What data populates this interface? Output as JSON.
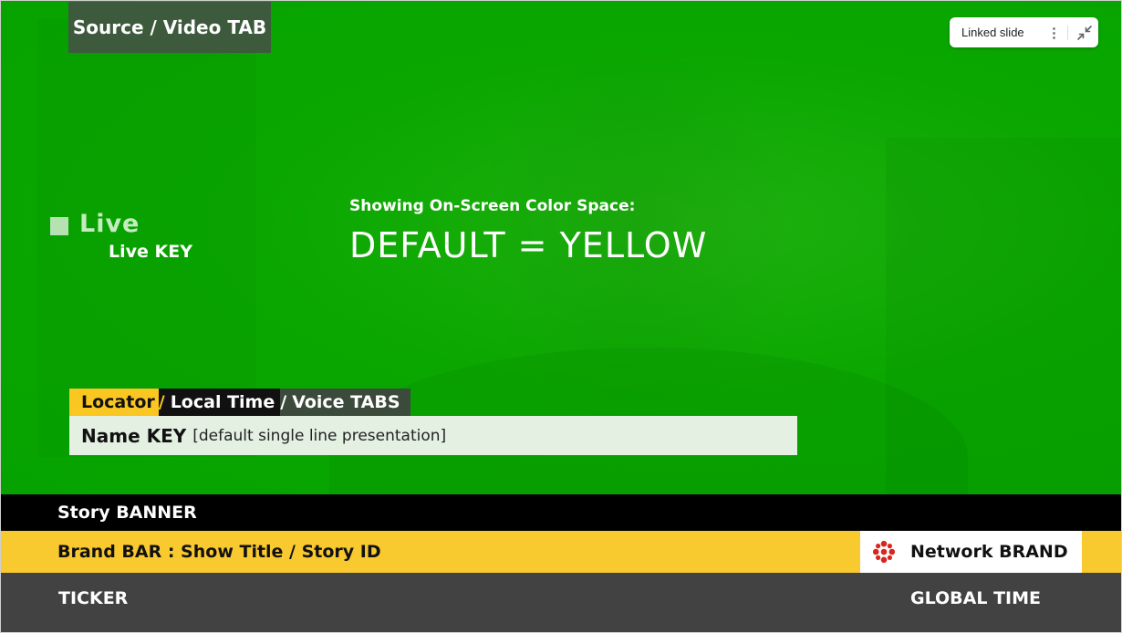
{
  "video": {
    "source_tab": "Source / Video TAB",
    "live_label": "Live",
    "live_key": "Live KEY",
    "color_space_label": "Showing On-Screen Color Space:",
    "color_space_value": "DEFAULT = YELLOW",
    "background_color": "#0aa700"
  },
  "linked_slide": {
    "label": "Linked slide",
    "more_icon": "more-vertical-icon",
    "collapse_icon": "collapse-icon"
  },
  "tabs": {
    "locator": "Locator",
    "slash": "/",
    "local_time": "Local Time",
    "voice": "Voice TABS"
  },
  "name_key": {
    "title": "Name KEY",
    "note": "[default single line presentation]"
  },
  "lower_third": {
    "story_banner": "Story BANNER",
    "brand_bar": "Brand BAR : Show Title / Story ID",
    "network_brand": "Network BRAND",
    "network_logo_icon": "cbc-gem-logo",
    "ticker": "TICKER",
    "global_time": "GLOBAL TIME"
  },
  "colors": {
    "yellow": "#f9c930",
    "black": "#000000",
    "ticker_gray": "#424242",
    "brand_red": "#d7261e"
  }
}
